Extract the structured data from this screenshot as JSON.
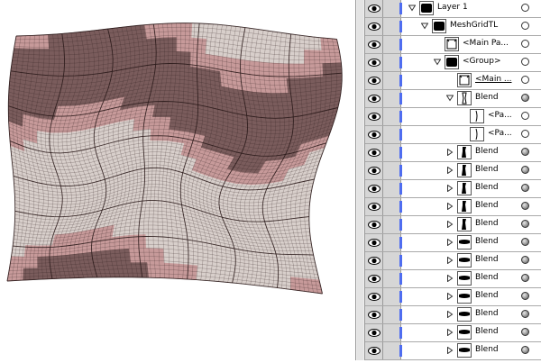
{
  "layers_panel": {
    "rows": [
      {
        "label": "Layer 1",
        "indent": 0,
        "twirl": "open",
        "thumb": "black",
        "target": "ring",
        "underline": false
      },
      {
        "label": "MeshGridTL",
        "indent": 1,
        "twirl": "open",
        "thumb": "black",
        "target": "ring",
        "underline": false
      },
      {
        "label": "<Main Pa...",
        "indent": 2,
        "twirl": "none",
        "thumb": "frame",
        "target": "ring",
        "underline": false
      },
      {
        "label": "<Group>",
        "indent": 2,
        "twirl": "open",
        "thumb": "black",
        "target": "ring",
        "underline": false
      },
      {
        "label": "<Main ...",
        "indent": 3,
        "twirl": "none",
        "thumb": "frame",
        "target": "ring",
        "underline": true
      },
      {
        "label": "Blend",
        "indent": 3,
        "twirl": "open",
        "thumb": "blend",
        "target": "filled",
        "underline": false
      },
      {
        "label": "<Pa...",
        "indent": 4,
        "twirl": "none",
        "thumb": "path",
        "target": "ring",
        "underline": false
      },
      {
        "label": "<Pa...",
        "indent": 4,
        "twirl": "none",
        "thumb": "path",
        "target": "ring",
        "underline": false
      },
      {
        "label": "Blend",
        "indent": 3,
        "twirl": "closed",
        "thumb": "vblend",
        "target": "filled",
        "underline": false
      },
      {
        "label": "Blend",
        "indent": 3,
        "twirl": "closed",
        "thumb": "vblend",
        "target": "filled",
        "underline": false
      },
      {
        "label": "Blend",
        "indent": 3,
        "twirl": "closed",
        "thumb": "vblend",
        "target": "filled",
        "underline": false
      },
      {
        "label": "Blend",
        "indent": 3,
        "twirl": "closed",
        "thumb": "vblend",
        "target": "filled",
        "underline": false
      },
      {
        "label": "Blend",
        "indent": 3,
        "twirl": "closed",
        "thumb": "vblend",
        "target": "filled",
        "underline": false
      },
      {
        "label": "Blend",
        "indent": 3,
        "twirl": "closed",
        "thumb": "hblend",
        "target": "filled",
        "underline": false
      },
      {
        "label": "Blend",
        "indent": 3,
        "twirl": "closed",
        "thumb": "hblend",
        "target": "filled",
        "underline": false
      },
      {
        "label": "Blend",
        "indent": 3,
        "twirl": "closed",
        "thumb": "hblend",
        "target": "filled",
        "underline": false
      },
      {
        "label": "Blend",
        "indent": 3,
        "twirl": "closed",
        "thumb": "hblend",
        "target": "filled",
        "underline": false
      },
      {
        "label": "Blend",
        "indent": 3,
        "twirl": "closed",
        "thumb": "hblend",
        "target": "filled",
        "underline": false
      },
      {
        "label": "Blend",
        "indent": 3,
        "twirl": "closed",
        "thumb": "hblend",
        "target": "filled",
        "underline": false
      },
      {
        "label": "Blend",
        "indent": 3,
        "twirl": "closed",
        "thumb": "hblend",
        "target": "filled",
        "underline": false
      }
    ]
  },
  "colors": {
    "mesh_fill_light": "#d8cfcb",
    "mesh_fill_pink": "#c79a9a",
    "mesh_fill_dark": "#7a5c5c",
    "mesh_line": "#2a1a1a",
    "layer_color_swatch": "#4f6df0",
    "panel_column": "#d6d6d6"
  }
}
